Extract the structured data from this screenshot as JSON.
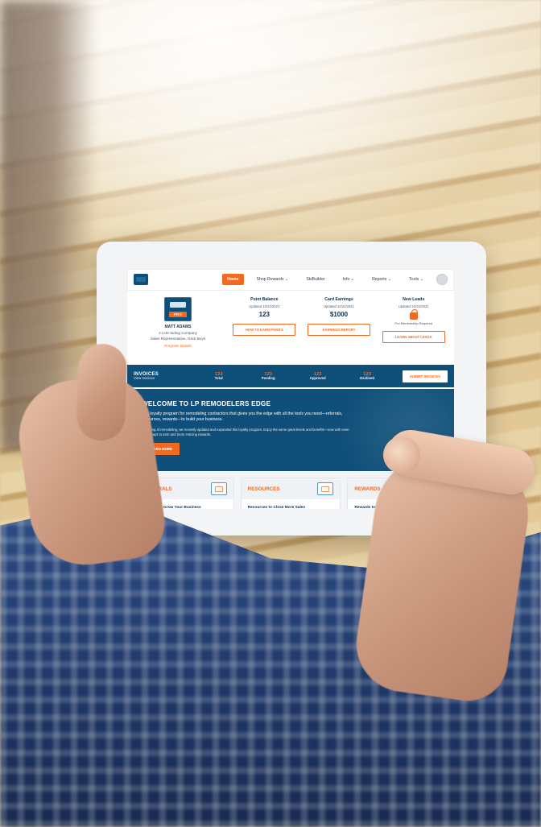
{
  "screen": {
    "nav": {
      "items": [
        {
          "label": "Home",
          "active": true
        },
        {
          "label": "Shop Rewards ⌄",
          "active": false
        },
        {
          "label": "SkiBuilder",
          "active": false
        },
        {
          "label": "Info ⌄",
          "active": false
        },
        {
          "label": "Reports ⌄",
          "active": false
        },
        {
          "label": "Tools ⌄",
          "active": false
        }
      ]
    },
    "profile": {
      "badge_label": "PRO",
      "name": "MATT ADAMS",
      "line1": "4 LHS Siding Company",
      "line2": "Sales Representative, Deck Buys",
      "link": "Progress Details"
    },
    "stats": [
      {
        "title": "Point Balance",
        "updated": "Updated 10/22/2021",
        "value": "123",
        "button": "HOW TO EARN POINTS"
      },
      {
        "title": "Card Earnings",
        "updated": "Updated 10/22/2021",
        "value": "$1000",
        "button": "EARNINGS REPORT"
      },
      {
        "title": "New Leads",
        "updated": "Updated 10/22/2021",
        "note": "Pro Membership Required",
        "button": "LEARN ABOUT LEADS"
      }
    ],
    "invoices": {
      "title": "INVOICES",
      "subtitle": "View Invoices",
      "stats": [
        {
          "count": "123",
          "label": "Total"
        },
        {
          "count": "123",
          "label": "Pending"
        },
        {
          "count": "123",
          "label": "Approved"
        },
        {
          "count": "123",
          "label": "Declined"
        }
      ],
      "button": "SUBMIT INVOICES"
    },
    "hero": {
      "title": "WELCOME TO LP REMODELERS EDGE",
      "p1": "The loyalty program for remodeling contractors that gives you the edge with all the tools you need—referrals, resources, rewards—to build your business.",
      "p2": "Speaking of remodeling, we recently updated and expanded this loyalty program. Enjoy the same great levels and benefits—now with even more ways to earn and more enticing rewards.",
      "cta": "LEARN MORE"
    },
    "cards": [
      {
        "title": "REFERRALS",
        "subtitle": "Referrals to Grow Your Business",
        "icon": "people-icon"
      },
      {
        "title": "RESOURCES",
        "subtitle": "Resources to Close More Sales",
        "icon": "laptop-icon"
      },
      {
        "title": "REWARDS",
        "subtitle": "Rewards to Reinvest in Your",
        "icon": "gift-icon"
      }
    ]
  },
  "colors": {
    "brand_orange": "#f26a21",
    "brand_navy": "#0e4f79"
  }
}
